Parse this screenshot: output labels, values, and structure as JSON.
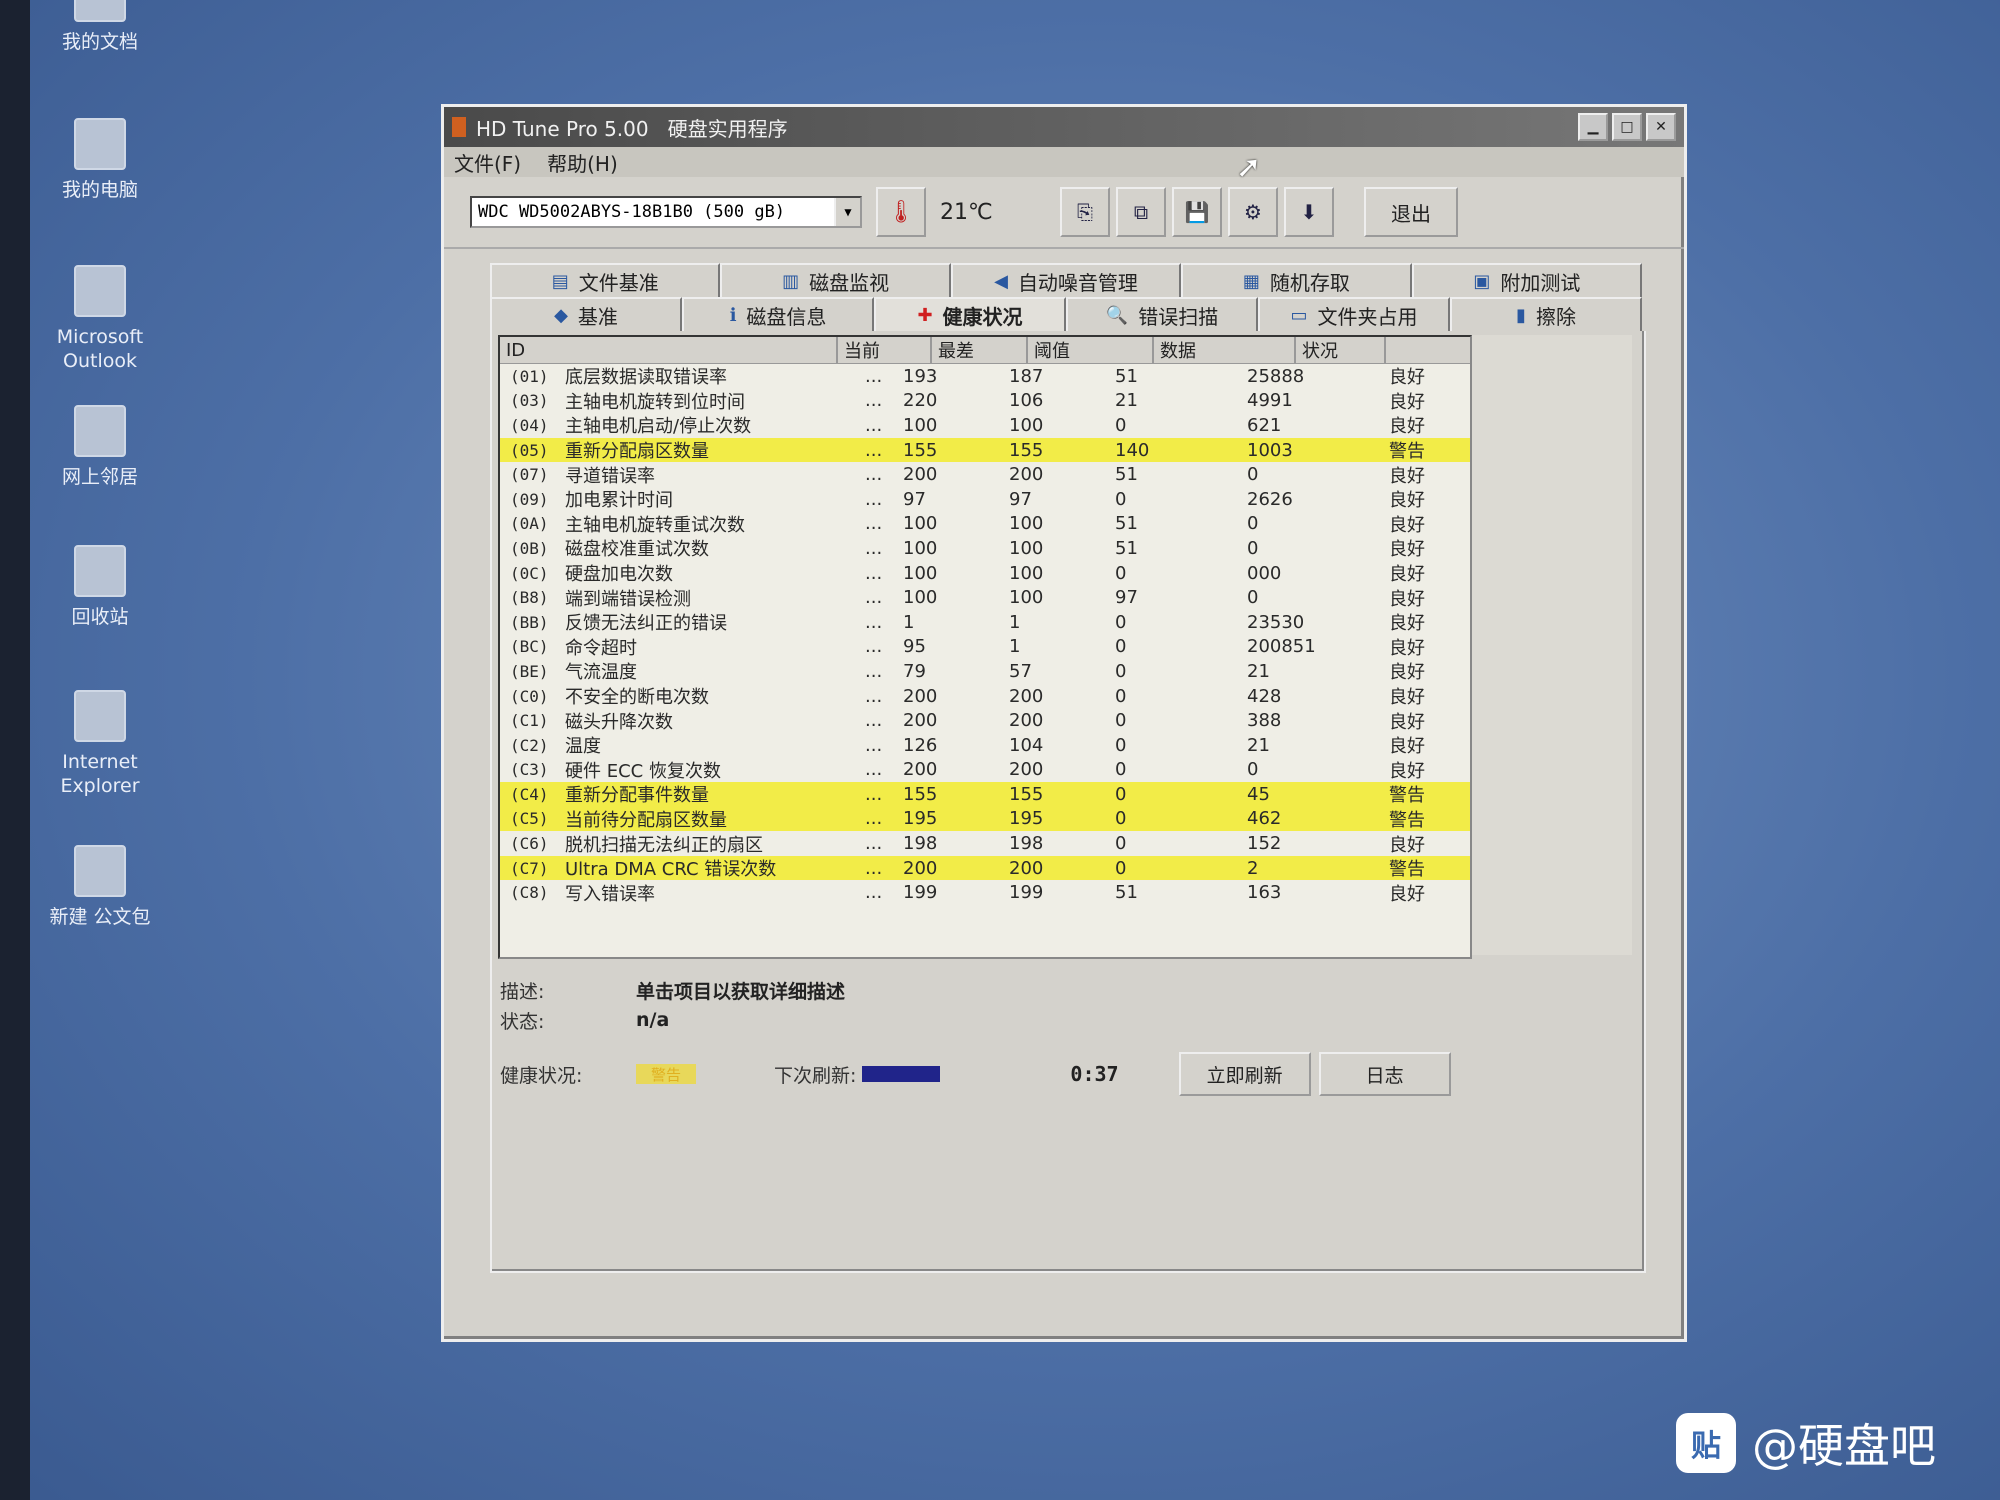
{
  "desktop": {
    "icons": [
      {
        "label": "我的文档"
      },
      {
        "label": "我的电脑"
      },
      {
        "label": "Microsoft\nOutlook"
      },
      {
        "label": "网上邻居"
      },
      {
        "label": "回收站"
      },
      {
        "label": "Internet\nExplorer"
      },
      {
        "label": "新建 公文包"
      }
    ]
  },
  "window": {
    "title": "HD Tune Pro 5.00   硬盘实用程序",
    "menu": [
      "文件(F)",
      "帮助(H)"
    ],
    "drive": "WDC WD5002ABYS-18B1B0 (500 gB)",
    "temperature": "21℃",
    "exit_label": "退出",
    "tabs_row1": [
      "文件基准",
      "磁盘监视",
      "自动噪音管理",
      "随机存取",
      "附加测试"
    ],
    "tabs_row2": [
      "基准",
      "磁盘信息",
      "健康状况",
      "错误扫描",
      "文件夹占用",
      "擦除"
    ],
    "active_tab": "健康状况",
    "columns": [
      "ID",
      "当前",
      "最差",
      "阈值",
      "数据",
      "状况"
    ],
    "rows": [
      {
        "id": "(01)",
        "name": "底层数据读取错误率",
        "cur": "193",
        "worst": "187",
        "thr": "51",
        "data": "25888",
        "status": "良好",
        "warn": false
      },
      {
        "id": "(03)",
        "name": "主轴电机旋转到位时间",
        "cur": "220",
        "worst": "106",
        "thr": "21",
        "data": "4991",
        "status": "良好",
        "warn": false
      },
      {
        "id": "(04)",
        "name": "主轴电机启动/停止次数",
        "cur": "100",
        "worst": "100",
        "thr": "0",
        "data": "621",
        "status": "良好",
        "warn": false
      },
      {
        "id": "(05)",
        "name": "重新分配扇区数量",
        "cur": "155",
        "worst": "155",
        "thr": "140",
        "data": "1003",
        "status": "警告",
        "warn": true
      },
      {
        "id": "(07)",
        "name": "寻道错误率",
        "cur": "200",
        "worst": "200",
        "thr": "51",
        "data": "0",
        "status": "良好",
        "warn": false
      },
      {
        "id": "(09)",
        "name": "加电累计时间",
        "cur": "97",
        "worst": "97",
        "thr": "0",
        "data": "2626",
        "status": "良好",
        "warn": false
      },
      {
        "id": "(0A)",
        "name": "主轴电机旋转重试次数",
        "cur": "100",
        "worst": "100",
        "thr": "51",
        "data": "0",
        "status": "良好",
        "warn": false
      },
      {
        "id": "(0B)",
        "name": "磁盘校准重试次数",
        "cur": "100",
        "worst": "100",
        "thr": "51",
        "data": "0",
        "status": "良好",
        "warn": false
      },
      {
        "id": "(0C)",
        "name": "硬盘加电次数",
        "cur": "100",
        "worst": "100",
        "thr": "0",
        "data": "000",
        "status": "良好",
        "warn": false
      },
      {
        "id": "(B8)",
        "name": "端到端错误检测",
        "cur": "100",
        "worst": "100",
        "thr": "97",
        "data": "0",
        "status": "良好",
        "warn": false
      },
      {
        "id": "(BB)",
        "name": "反馈无法纠正的错误",
        "cur": "1",
        "worst": "1",
        "thr": "0",
        "data": "23530",
        "status": "良好",
        "warn": false
      },
      {
        "id": "(BC)",
        "name": "命令超时",
        "cur": "95",
        "worst": "1",
        "thr": "0",
        "data": "200851",
        "status": "良好",
        "warn": false
      },
      {
        "id": "(BE)",
        "name": "气流温度",
        "cur": "79",
        "worst": "57",
        "thr": "0",
        "data": "21",
        "status": "良好",
        "warn": false
      },
      {
        "id": "(C0)",
        "name": "不安全的断电次数",
        "cur": "200",
        "worst": "200",
        "thr": "0",
        "data": "428",
        "status": "良好",
        "warn": false
      },
      {
        "id": "(C1)",
        "name": "磁头升降次数",
        "cur": "200",
        "worst": "200",
        "thr": "0",
        "data": "388",
        "status": "良好",
        "warn": false
      },
      {
        "id": "(C2)",
        "name": "温度",
        "cur": "126",
        "worst": "104",
        "thr": "0",
        "data": "21",
        "status": "良好",
        "warn": false
      },
      {
        "id": "(C3)",
        "name": "硬件 ECC 恢复次数",
        "cur": "200",
        "worst": "200",
        "thr": "0",
        "data": "0",
        "status": "良好",
        "warn": false
      },
      {
        "id": "(C4)",
        "name": "重新分配事件数量",
        "cur": "155",
        "worst": "155",
        "thr": "0",
        "data": "45",
        "status": "警告",
        "warn": true
      },
      {
        "id": "(C5)",
        "name": "当前待分配扇区数量",
        "cur": "195",
        "worst": "195",
        "thr": "0",
        "data": "462",
        "status": "警告",
        "warn": true
      },
      {
        "id": "(C6)",
        "name": "脱机扫描无法纠正的扇区",
        "cur": "198",
        "worst": "198",
        "thr": "0",
        "data": "152",
        "status": "良好",
        "warn": false
      },
      {
        "id": "(C7)",
        "name": "Ultra DMA CRC 错误次数",
        "cur": "200",
        "worst": "200",
        "thr": "0",
        "data": "2",
        "status": "警告",
        "warn": true
      },
      {
        "id": "(C8)",
        "name": "写入错误率",
        "cur": "199",
        "worst": "199",
        "thr": "51",
        "data": "163",
        "status": "良好",
        "warn": false
      }
    ],
    "row_dots": "...",
    "desc_label": "描述:",
    "desc_value": "单击项目以获取详细描述",
    "state_label": "状态:",
    "state_value": "n/a",
    "health_label": "健康状况:",
    "health_value": "警告",
    "next_refresh_label": "下次刷新:",
    "countdown": "0:37",
    "refresh_label": "立即刷新",
    "log_label": "日志"
  },
  "watermark": {
    "icon": "贴",
    "text": "@硬盘吧"
  }
}
